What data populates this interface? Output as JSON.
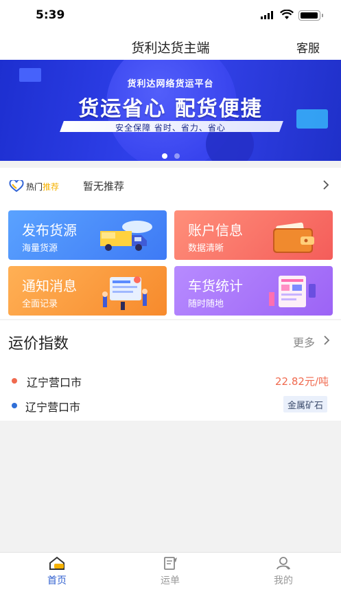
{
  "status_bar": {
    "time": "5:39"
  },
  "header": {
    "title": "货利达货主端",
    "service_label": "客服"
  },
  "banner": {
    "subtitle": "货利达网络货运平台",
    "headline": "货运省心 配货便捷",
    "tagline": "安全保障 省时、省力、省心",
    "page_count": 2,
    "active_page": 1
  },
  "hot": {
    "label_main": "热门",
    "label_accent": "推荐",
    "text": "暂无推荐"
  },
  "menu": [
    {
      "title": "发布货源",
      "subtitle": "海量货源",
      "icon": "truck-icon",
      "color": "#4b8ffa"
    },
    {
      "title": "账户信息",
      "subtitle": "数据清晰",
      "icon": "wallet-icon",
      "color": "#f7705f"
    },
    {
      "title": "通知消息",
      "subtitle": "全面记录",
      "icon": "notification-icon",
      "color": "#f99a3f"
    },
    {
      "title": "车货统计",
      "subtitle": "随时随地",
      "icon": "statistics-icon",
      "color": "#a772f8"
    }
  ],
  "freight_index": {
    "title": "运价指数",
    "more_label": "更多",
    "rows": [
      {
        "city": "辽宁营口市",
        "value": "22.82元/吨",
        "dot_color": "#f06a4f"
      },
      {
        "city": "辽宁营口市",
        "value": "金属矿石",
        "dot_color": "#2f6fd8"
      }
    ]
  },
  "tabbar": {
    "items": [
      {
        "label": "首页",
        "icon": "home-icon",
        "active": true
      },
      {
        "label": "运单",
        "icon": "waybill-icon",
        "active": false
      },
      {
        "label": "我的",
        "icon": "profile-icon",
        "active": false
      }
    ]
  },
  "colors": {
    "accent": "#2f5fcf",
    "price": "#f06a4f",
    "hot_accent": "#f5b100"
  }
}
